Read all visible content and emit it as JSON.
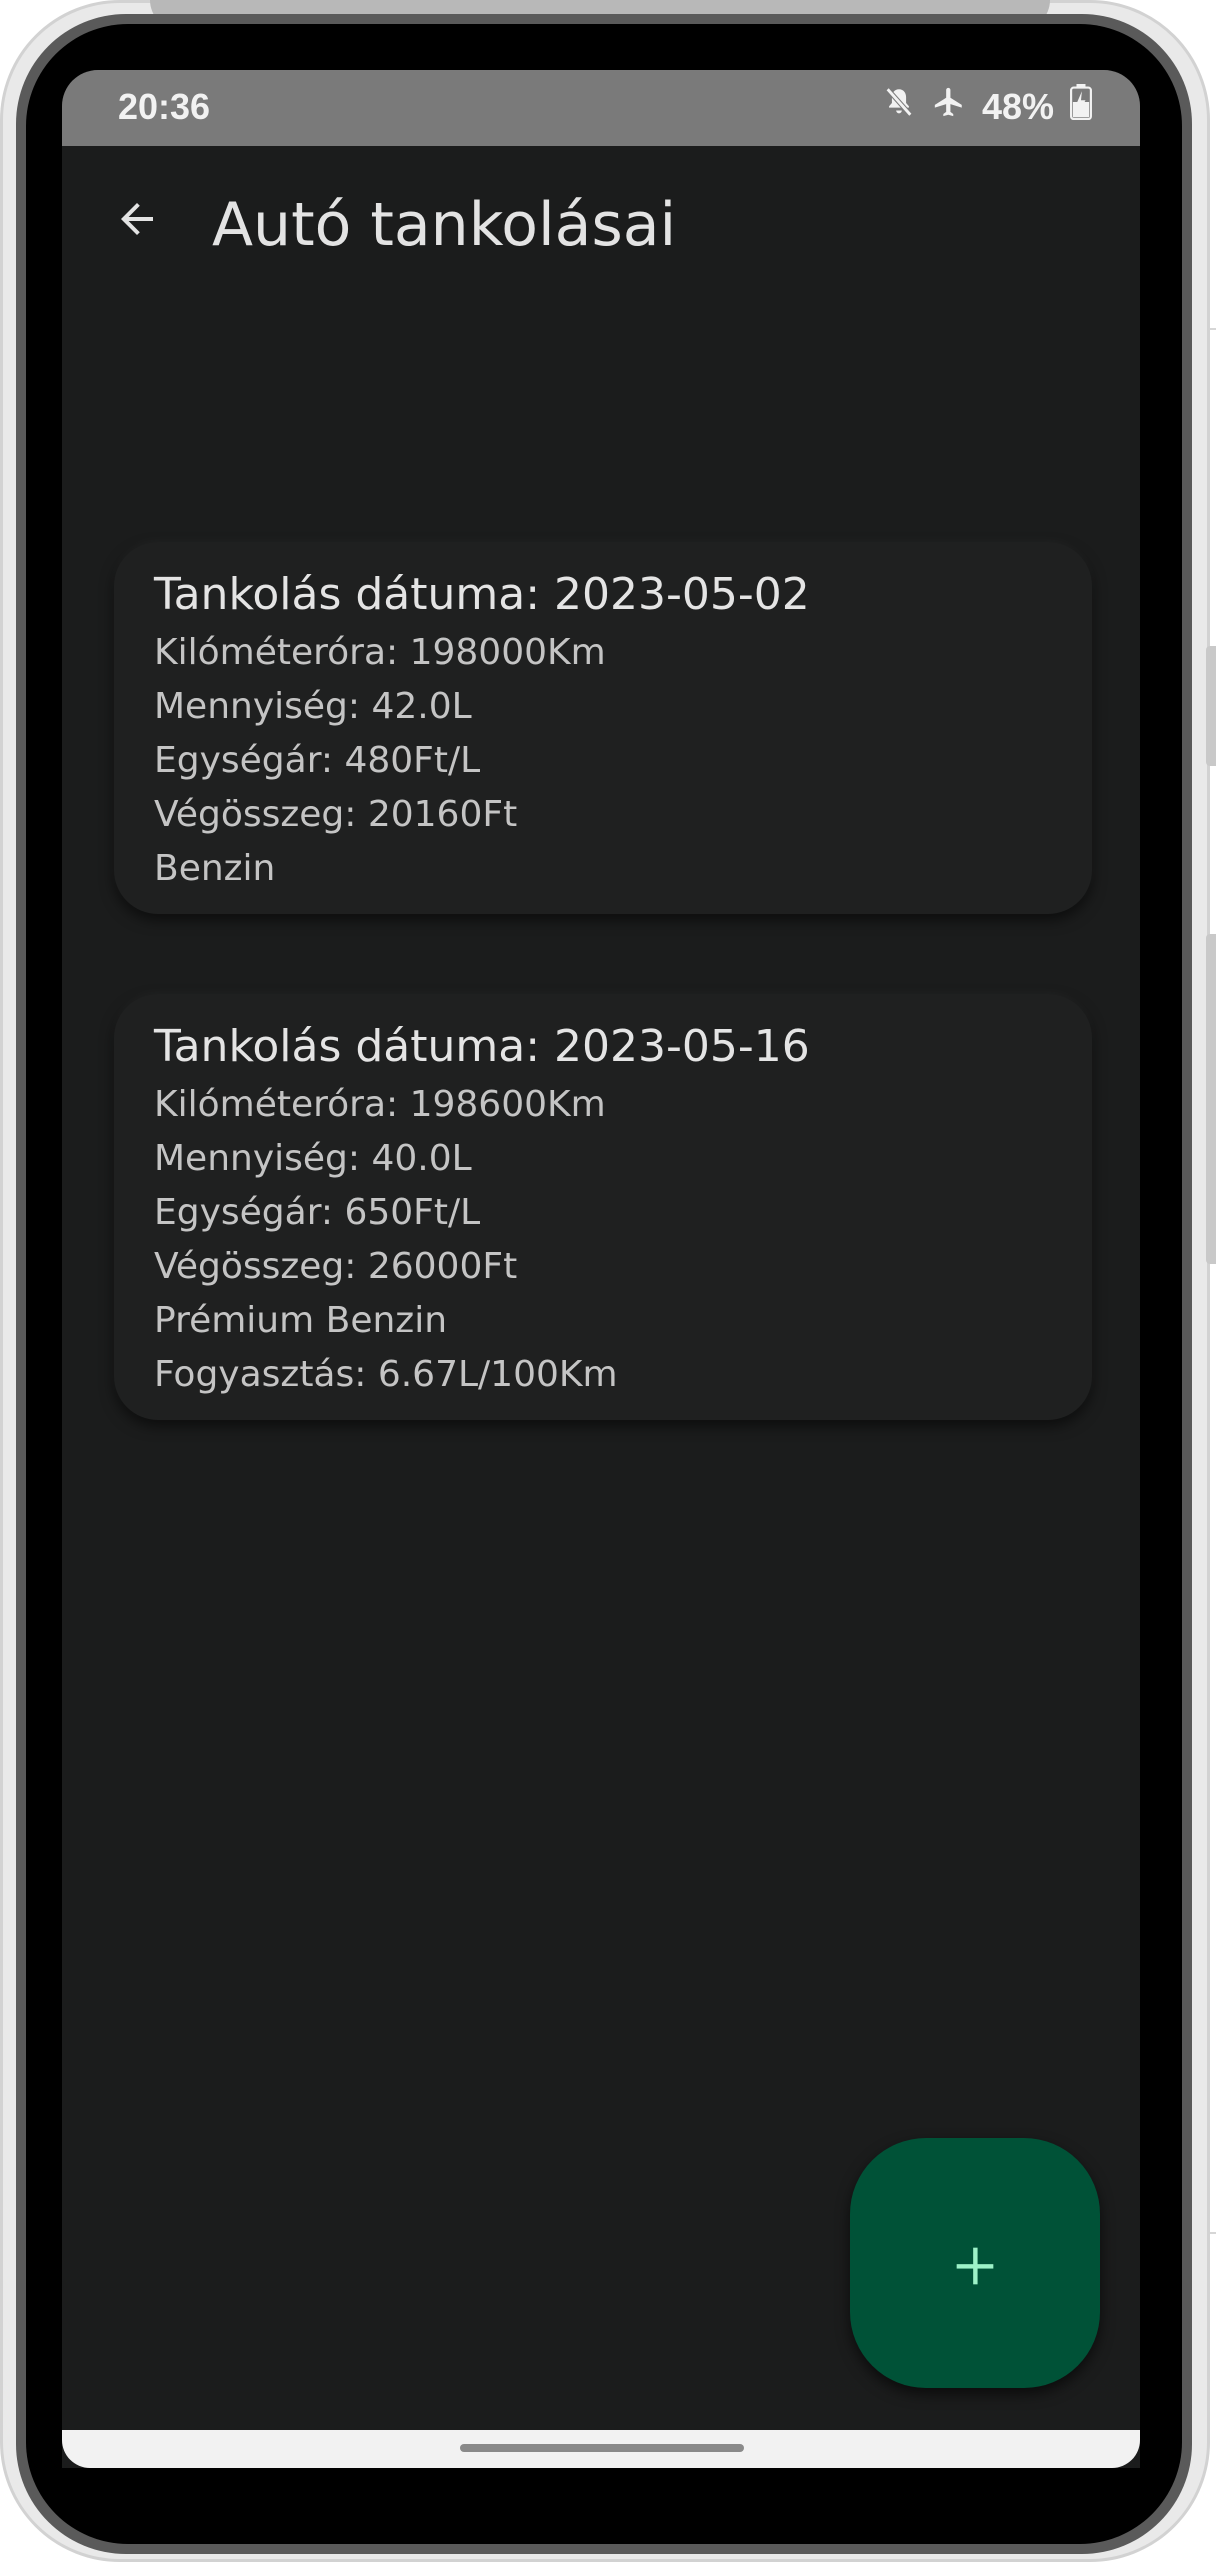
{
  "status_bar": {
    "time": "20:36",
    "battery": "48%",
    "icons": [
      "mute-icon",
      "airplane-icon",
      "battery-icon"
    ]
  },
  "app_bar": {
    "title": "Autó tankolásai",
    "back_icon": "arrow-back-icon"
  },
  "refuels": [
    {
      "title": "Tankolás dátuma: 2023-05-02",
      "odometer": "Kilóméteróra: 198000Km",
      "amount": "Mennyiség: 42.0L",
      "unit_price": "Egységár: 480Ft/L",
      "total": "Végösszeg: 20160Ft",
      "fuel_type": "Benzin"
    },
    {
      "title": "Tankolás dátuma: 2023-05-16",
      "odometer": "Kilóméteróra: 198600Km",
      "amount": "Mennyiség: 40.0L",
      "unit_price": "Egységár: 650Ft/L",
      "total": "Végösszeg: 26000Ft",
      "fuel_type": "Prémium Benzin",
      "consumption": "Fogyasztás: 6.67L/100Km"
    }
  ],
  "fab": {
    "label": "+",
    "icon": "plus-icon"
  },
  "colors": {
    "background": "#1b1c1c",
    "card": "#1f2020",
    "fab": "#005237",
    "fab_icon": "#9df2c8"
  }
}
